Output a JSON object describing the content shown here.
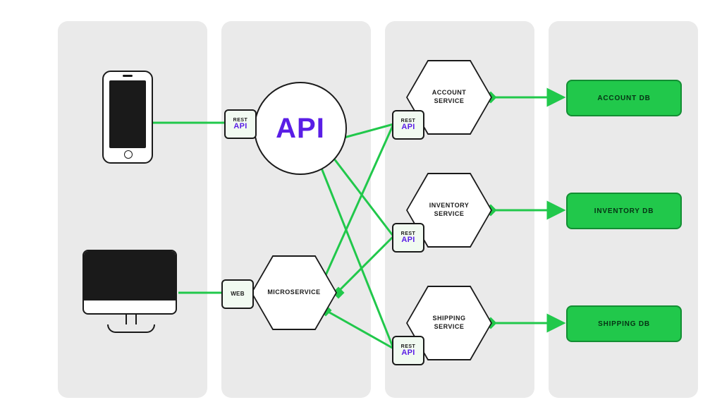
{
  "tags": {
    "rest_word": "REST",
    "api_word": "API",
    "web_word": "WEB"
  },
  "gateway": {
    "big_api": "API",
    "microservice": "MICROSERVICE"
  },
  "services": {
    "account": "ACCOUNT\nSERVICE",
    "inventory": "INVENTORY\nSERVICE",
    "shipping": "SHIPPING\nSERVICE"
  },
  "databases": {
    "account": "ACCOUNT DB",
    "inventory": "INVENTORY DB",
    "shipping": "SHIPPING DB"
  },
  "colors": {
    "green": "#21C84B",
    "green_dark": "#138E33",
    "purple": "#5A1EE6",
    "panel": "#EAEAEA"
  }
}
